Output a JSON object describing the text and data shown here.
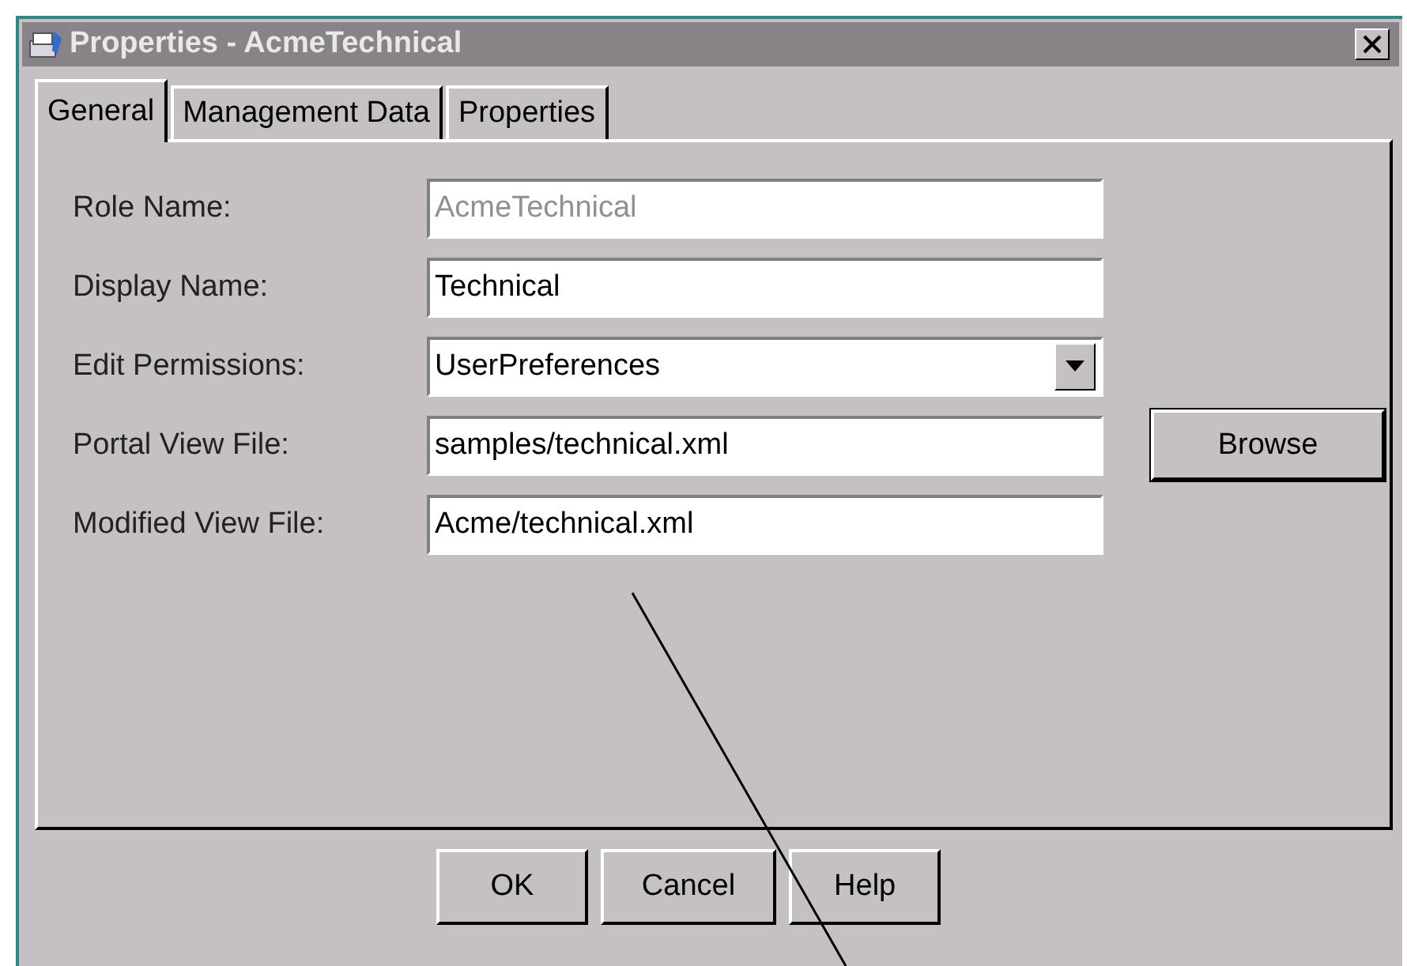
{
  "window": {
    "title": "Properties - AcmeTechnical"
  },
  "tabs": [
    {
      "label": "General",
      "selected": true
    },
    {
      "label": "Management Data",
      "selected": false
    },
    {
      "label": "Properties",
      "selected": false
    }
  ],
  "fields": [
    {
      "label": "Role Name:",
      "kind": "text",
      "value": "AcmeTechnical",
      "disabled": true
    },
    {
      "label": "Display Name:",
      "kind": "text",
      "value": "Technical",
      "disabled": false
    },
    {
      "label": "Edit Permissions:",
      "kind": "dropdown",
      "value": "UserPreferences",
      "disabled": false
    },
    {
      "label": "Portal View File:",
      "kind": "text",
      "value": "samples/technical.xml",
      "disabled": false,
      "button": "Browse"
    },
    {
      "label": "Modified View File:",
      "kind": "text",
      "value": "Acme/technical.xml",
      "disabled": false
    }
  ],
  "buttons": [
    "OK",
    "Cancel",
    "Help"
  ]
}
